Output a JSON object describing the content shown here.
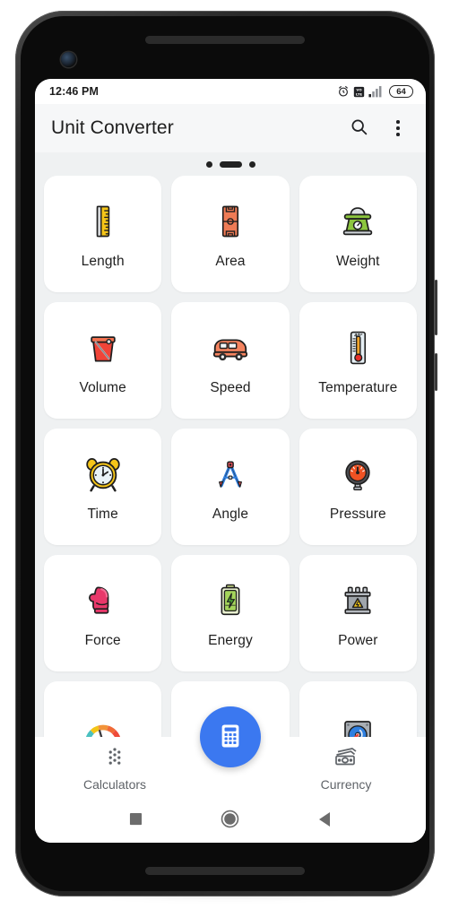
{
  "status_bar": {
    "time": "12:46 PM",
    "alarm_icon": "alarm-clock-icon",
    "volte_icon": "volte-icon",
    "signal_icon": "signal-bars-icon",
    "battery_level": "64"
  },
  "app_bar": {
    "title": "Unit Converter",
    "search_icon": "search-icon",
    "overflow_icon": "more-vertical-icon"
  },
  "pager": {
    "total": 3,
    "active_index": 1
  },
  "grid": {
    "items": [
      {
        "label": "Length",
        "icon": "ruler-icon"
      },
      {
        "label": "Area",
        "icon": "field-area-icon"
      },
      {
        "label": "Weight",
        "icon": "kitchen-scale-icon"
      },
      {
        "label": "Volume",
        "icon": "bucket-icon"
      },
      {
        "label": "Speed",
        "icon": "van-icon"
      },
      {
        "label": "Temperature",
        "icon": "thermometer-icon"
      },
      {
        "label": "Time",
        "icon": "alarm-clock-icon"
      },
      {
        "label": "Angle",
        "icon": "compass-divider-icon"
      },
      {
        "label": "Pressure",
        "icon": "pressure-gauge-icon"
      },
      {
        "label": "Force",
        "icon": "boxing-glove-icon"
      },
      {
        "label": "Energy",
        "icon": "battery-bolt-icon"
      },
      {
        "label": "Power",
        "icon": "transformer-icon"
      },
      {
        "label": "",
        "icon": "speedometer-icon"
      },
      {
        "label": "",
        "icon": "hidden-behind-fab"
      },
      {
        "label": "",
        "icon": "hard-disk-icon"
      }
    ]
  },
  "bottom_nav": {
    "left": {
      "label": "Calculators",
      "icon": "dots-cluster-icon"
    },
    "right": {
      "label": "Currency",
      "icon": "banknotes-icon"
    },
    "fab": {
      "icon": "calculator-icon",
      "color": "#3b78f0"
    }
  },
  "android_nav": {
    "recents_icon": "square-recents-icon",
    "home_icon": "circle-home-icon",
    "back_icon": "triangle-back-icon"
  },
  "colors": {
    "screen_bg": "#eff1f2",
    "card_bg": "#ffffff",
    "accent": "#3b78f0",
    "text": "#1f1f1f"
  }
}
